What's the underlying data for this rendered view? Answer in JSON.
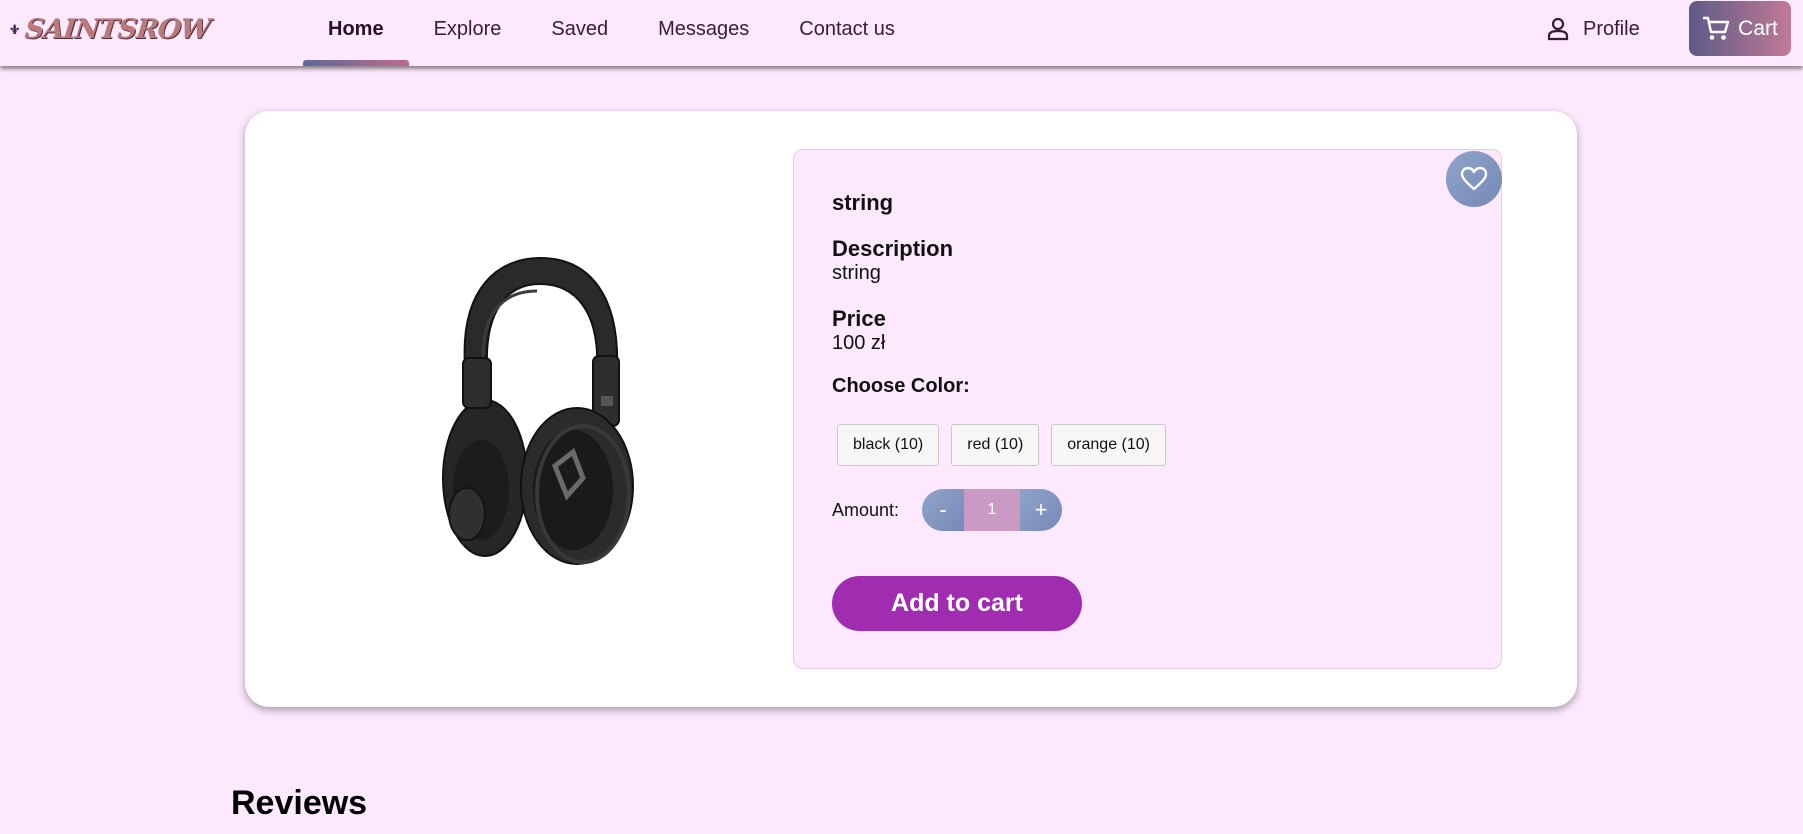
{
  "header": {
    "logo_text": "SAINTSROW",
    "nav": [
      {
        "label": "Home",
        "active": true
      },
      {
        "label": "Explore",
        "active": false
      },
      {
        "label": "Saved",
        "active": false
      },
      {
        "label": "Messages",
        "active": false
      },
      {
        "label": "Contact us",
        "active": false
      }
    ],
    "profile_label": "Profile",
    "cart_label": "Cart",
    "icons": {
      "profile": "person-icon",
      "cart": "cart-icon",
      "logo": "fleur-de-lis-icon"
    }
  },
  "product": {
    "name": "string",
    "description_label": "Description",
    "description": "string",
    "price_label": "Price",
    "price": "100 zł",
    "choose_color_label": "Choose Color:",
    "colors": [
      "black (10)",
      "red (10)",
      "orange (10)"
    ],
    "amount_label": "Amount:",
    "decrement": "-",
    "increment": "+",
    "amount": "1",
    "add_to_cart": "Add to cart",
    "favorite_icon": "heart-icon",
    "image": "headphones"
  },
  "reviews": {
    "title": "Reviews"
  },
  "colors": {
    "background": "#fde9fd",
    "accent": "#a02cb0",
    "stepper": "#7689b8",
    "stepper_value": "#c99ac4"
  }
}
